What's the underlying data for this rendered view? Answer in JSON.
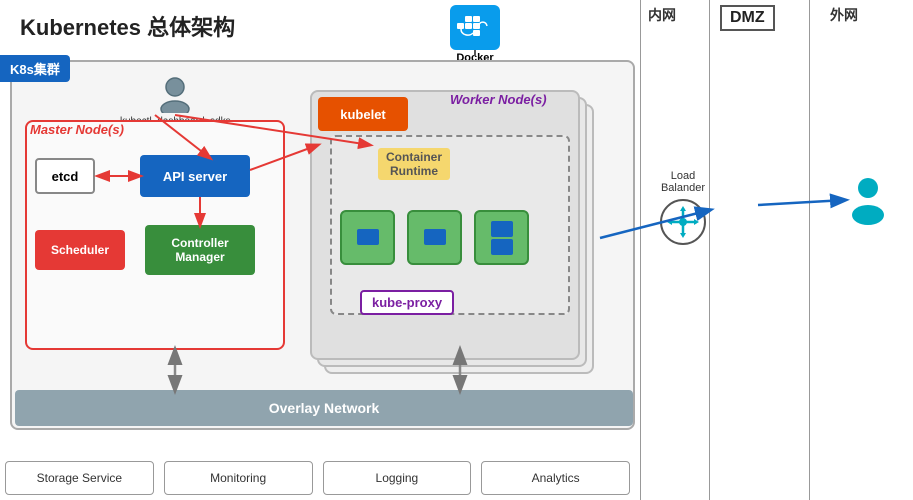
{
  "title": "Kubernetes 总体架构",
  "badge": "K8s集群",
  "docker_hub": {
    "label": "Docker\nHub",
    "icon_color": "#099cec"
  },
  "zones": {
    "intranet": "内网",
    "dmz": "DMZ",
    "external": "外网"
  },
  "master_node": {
    "label": "Master Node(s)",
    "etcd": "etcd",
    "api_server": "API server",
    "scheduler": "Scheduler",
    "controller_manager": "Controller\nManager"
  },
  "worker_node": {
    "label": "Worker Node(s)",
    "kubelet": "kubelet",
    "container_runtime": "Container\nRuntime",
    "kube_proxy": "kube-proxy"
  },
  "user_caption": "kubectl, dashboard, sdks",
  "overlay_network": "Overlay Network",
  "services": [
    "Storage Service",
    "Monitoring",
    "Logging",
    "Analytics"
  ],
  "load_balancer": {
    "label": "Load\nBalander"
  }
}
